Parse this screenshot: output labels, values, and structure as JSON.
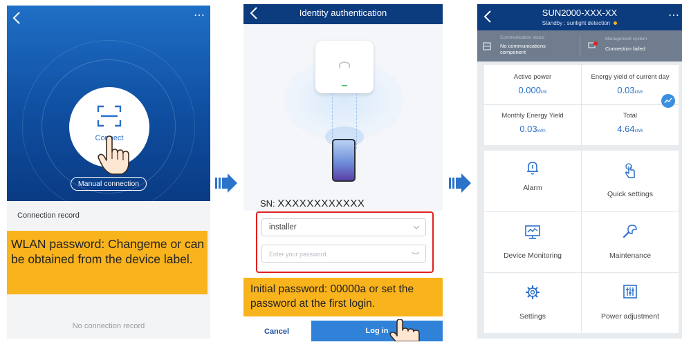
{
  "screen1": {
    "more_label": "⋯",
    "connect_label": "Connect",
    "manual_connection_label": "Manual connection",
    "connection_record_heading": "Connection record",
    "note_text": "WLAN password: Changeme or can be obtained from the device label.",
    "no_record_text": "No connection record"
  },
  "screen2": {
    "title": "Identity authentication",
    "sn_label": "SN:",
    "sn_value": "XXXXXXXXXXXX",
    "username_value": "installer",
    "password_placeholder": "Enter your password.",
    "note_text": "Initial password: 00000a or set the password at the first login.",
    "cancel_label": "Cancel",
    "login_label": "Log in"
  },
  "screen3": {
    "title": "SUN2000-XXX-XX",
    "subtitle": "Standby : sunlight detection",
    "comm_status_label": "Communication status",
    "comm_status_value": "No communications component",
    "mgmt_system_label": "Management system",
    "mgmt_system_value": "Connection failed",
    "more_label": "⋯",
    "metrics": [
      {
        "label": "Active power",
        "value": "0.000",
        "unit": "kW"
      },
      {
        "label": "Energy yield of current day",
        "value": "0.03",
        "unit": "kWh"
      },
      {
        "label": "Monthly Energy Yield",
        "value": "0.03",
        "unit": "kWh"
      },
      {
        "label": "Total",
        "value": "4.64",
        "unit": "kWh"
      }
    ],
    "menu": [
      {
        "label": "Alarm",
        "icon": "bell-icon"
      },
      {
        "label": "Quick settings",
        "icon": "hand-touch-icon"
      },
      {
        "label": "Device Monitoring",
        "icon": "monitor-icon"
      },
      {
        "label": "Maintenance",
        "icon": "wrench-icon"
      },
      {
        "label": "Settings",
        "icon": "gear-icon"
      },
      {
        "label": "Power adjustment",
        "icon": "sliders-icon"
      }
    ]
  },
  "colors": {
    "brand_blue": "#0c3b7e",
    "accent_blue": "#2f82d8",
    "note_yellow": "#f9b31d",
    "highlight_red": "#e02020"
  }
}
